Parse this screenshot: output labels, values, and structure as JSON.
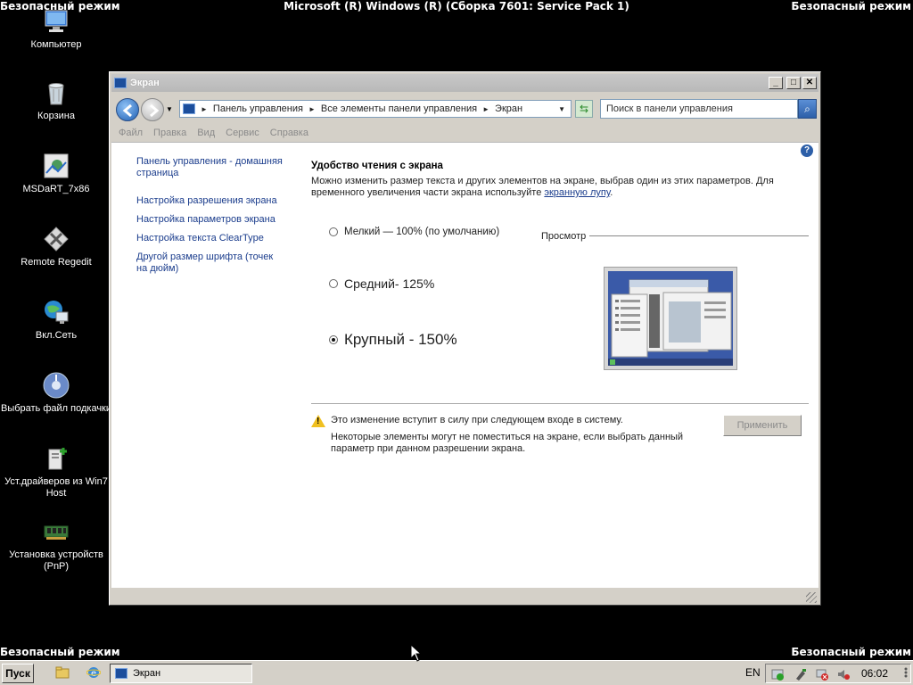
{
  "system": {
    "safe_mode": "Безопасный режим",
    "os_title": "Microsoft (R) Windows (R) (Сборка 7601: Service Pack 1)"
  },
  "desktop_icons": [
    {
      "label": "Компьютер",
      "icon": "computer-icon"
    },
    {
      "label": "Корзина",
      "icon": "recycle-bin-icon"
    },
    {
      "label": "MSDaRT_7x86",
      "icon": "msdart-icon"
    },
    {
      "label": "Remote Regedit",
      "icon": "regedit-icon"
    },
    {
      "label": "Вкл.Сеть",
      "icon": "network-icon"
    },
    {
      "label": "Выбрать файл подкачки",
      "icon": "pagefile-icon"
    },
    {
      "label": "Уст.драйверов из Win7 Host",
      "icon": "drivers-icon"
    },
    {
      "label": "Установка устройств (PnP)",
      "icon": "pnp-icon"
    }
  ],
  "window": {
    "title": "Экран",
    "address": {
      "crumbs": [
        "Панель управления",
        "Все элементы панели управления",
        "Экран"
      ]
    },
    "search_placeholder": "Поиск в панели управления",
    "menu": [
      "Файл",
      "Правка",
      "Вид",
      "Сервис",
      "Справка"
    ],
    "sidebar": [
      "Панель управления - домашняя страница",
      "Настройка разрешения экрана",
      "Настройка параметров экрана",
      "Настройка текста ClearType",
      "Другой размер шрифта (точек на дюйм)"
    ],
    "heading": "Удобство чтения с экрана",
    "description": "Можно изменить размер текста и других элементов на экране, выбрав один из этих параметров. Для временного увеличения части экрана используйте",
    "description_link": "экранную лупу",
    "description_end": ".",
    "options": [
      {
        "label": "Мелкий — 100% (по умолчанию)",
        "selected": false
      },
      {
        "label": "Средний- 125%",
        "selected": false
      },
      {
        "label": "Крупный - 150%",
        "selected": true
      }
    ],
    "preview_label": "Просмотр",
    "warning_line1": "Это изменение вступит в силу при следующем входе в систему.",
    "warning_line2": "Некоторые элементы могут не поместиться на экране, если выбрать данный параметр при данном разрешении экрана.",
    "apply_label": "Применить"
  },
  "taskbar": {
    "start_label": "Пуск",
    "task_label": "Экран",
    "language": "EN",
    "clock": "06:02"
  },
  "colors": {
    "desktop": "#000000",
    "link": "#1a3c8c",
    "window_chrome": "#d4d0c8"
  }
}
